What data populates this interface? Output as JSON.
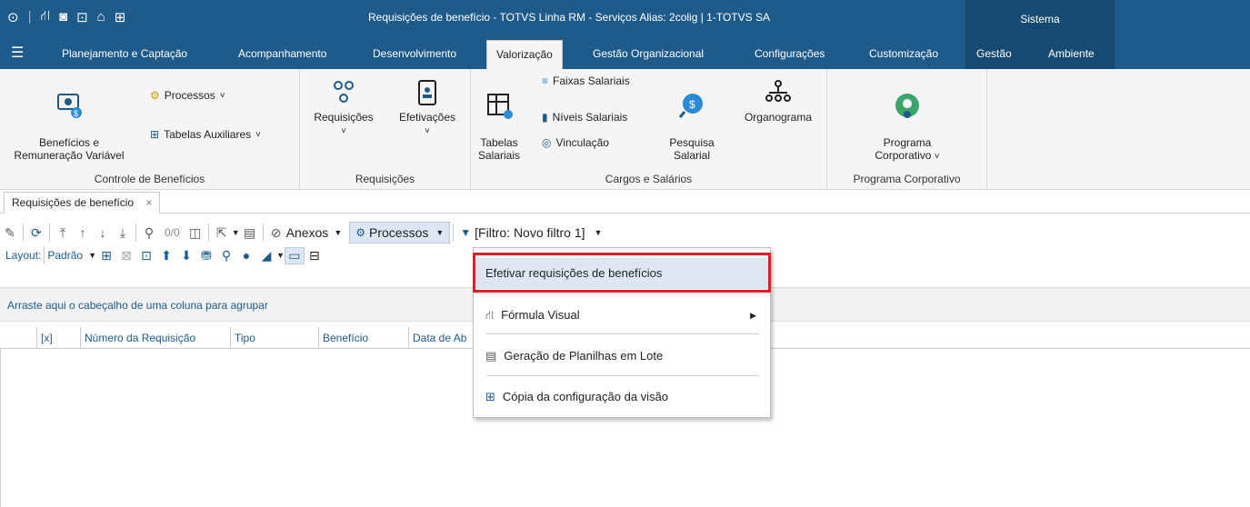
{
  "titlebar": {
    "title": "Requisições de benefício - TOTVS Linha RM - Serviços  Alias: 2colig | 1-TOTVS SA",
    "system": "Sistema"
  },
  "menu_tabs": [
    {
      "label": "Planejamento e Captação"
    },
    {
      "label": "Acompanhamento"
    },
    {
      "label": "Desenvolvimento"
    },
    {
      "label": "Valorização"
    },
    {
      "label": "Gestão Organizacional"
    },
    {
      "label": "Configurações"
    },
    {
      "label": "Customização"
    },
    {
      "label": "Gestão"
    },
    {
      "label": "Ambiente"
    }
  ],
  "ribbon": {
    "groups": [
      {
        "label": "Controle de Benefícios"
      },
      {
        "label": "Requisições"
      },
      {
        "label": "Cargos e Salários"
      },
      {
        "label": "Programa Corporativo"
      }
    ],
    "beneficios": "Benefícios e\nRemuneração Variável",
    "processos": "Processos",
    "tabelas_aux": "Tabelas Auxiliares",
    "requisicoes": "Requisições",
    "efetivacoes": "Efetivações",
    "tabelas_salariais": "Tabelas\nSalariais",
    "faixas": "Faixas Salariais",
    "niveis": "Níveis Salariais",
    "vinculacao": "Vinculação",
    "pesquisa": "Pesquisa\nSalarial",
    "organograma": "Organograma",
    "programa": "Programa\nCorporativo"
  },
  "doc_tab": {
    "label": "Requisições de benefício",
    "close": "×"
  },
  "toolbar": {
    "counter": "0/0",
    "anexos": "Anexos",
    "processos": "Processos",
    "filtro": "[Filtro: Novo filtro 1]",
    "layout_label": "Layout:",
    "layout_value": "Padrão"
  },
  "group_hint": "Arraste aqui o cabeçalho de uma coluna para agrupar",
  "columns": [
    {
      "label": "[x]"
    },
    {
      "label": "Número da Requisição"
    },
    {
      "label": "Tipo"
    },
    {
      "label": "Benefício"
    },
    {
      "label": "Data de Ab"
    }
  ],
  "dropdown": {
    "items": [
      {
        "label": "Efetivar requisições de benefícios"
      },
      {
        "label": "Fórmula Visual"
      },
      {
        "label": "Geração de Planilhas em Lote"
      },
      {
        "label": "Cópia da configuração da visão"
      }
    ]
  },
  "colors": {
    "brand": "#1e5a8a",
    "highlight_border": "#e02020",
    "menu_highlight": "#dde7f3"
  }
}
